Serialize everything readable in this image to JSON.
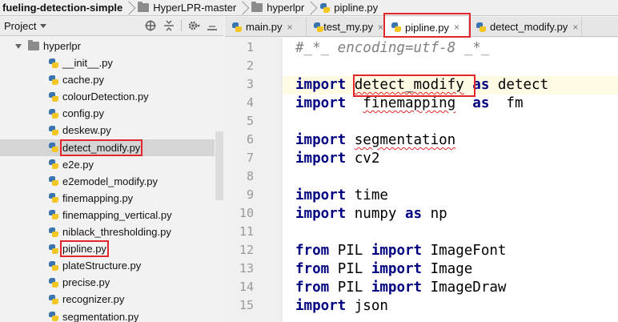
{
  "breadcrumb": {
    "items": [
      {
        "label": "fueling-detection-simple",
        "icon": "none"
      },
      {
        "label": "HyperLPR-master",
        "icon": "folder-icon"
      },
      {
        "label": "hyperlpr",
        "icon": "folder-icon"
      },
      {
        "label": "pipline.py",
        "icon": "python-file-icon"
      }
    ]
  },
  "project_panel": {
    "title": "Project",
    "tools": [
      "globe-icon",
      "collapse-icon",
      "gear-icon",
      "hide-icon"
    ],
    "root_folder": "hyperlpr",
    "files": [
      "__init__.py",
      "cache.py",
      "colourDetection.py",
      "config.py",
      "deskew.py",
      "detect_modify.py",
      "e2e.py",
      "e2emodel_modify.py",
      "finemapping.py",
      "finemapping_vertical.py",
      "niblack_thresholding.py",
      "pipline.py",
      "plateStructure.py",
      "precise.py",
      "recognizer.py",
      "segmentation.py"
    ],
    "selected_file": "detect_modify.py"
  },
  "tabs": [
    {
      "label": "main.py",
      "close": "×",
      "active": false
    },
    {
      "label": "test_my.py",
      "close": "×",
      "active": false
    },
    {
      "label": "pipline.py",
      "close": "×",
      "active": true
    },
    {
      "label": "detect_modify.py",
      "close": "×",
      "active": false
    }
  ],
  "editor": {
    "line_numbers": [
      "1",
      "2",
      "3",
      "4",
      "5",
      "6",
      "7",
      "8",
      "9",
      "10",
      "11",
      "12",
      "13",
      "14",
      "15"
    ],
    "current_line": 3,
    "lines": [
      [
        {
          "t": "#_*_ encoding=utf-8 _*_",
          "c": "comment"
        }
      ],
      [],
      [
        {
          "t": "import",
          "c": "kw"
        },
        {
          "t": " "
        },
        {
          "t": "detect_modify",
          "c": "squig"
        },
        {
          "t": " "
        },
        {
          "t": "as",
          "c": "kw"
        },
        {
          "t": " detect"
        }
      ],
      [
        {
          "t": "import",
          "c": "kw"
        },
        {
          "t": "  "
        },
        {
          "t": "finemapping",
          "c": "squig"
        },
        {
          "t": "  "
        },
        {
          "t": "as",
          "c": "kw"
        },
        {
          "t": "  fm"
        }
      ],
      [],
      [
        {
          "t": "import",
          "c": "kw"
        },
        {
          "t": " "
        },
        {
          "t": "segmentation",
          "c": "squig"
        }
      ],
      [
        {
          "t": "import",
          "c": "kw"
        },
        {
          "t": " cv2"
        }
      ],
      [],
      [
        {
          "t": "import",
          "c": "kw"
        },
        {
          "t": " time"
        }
      ],
      [
        {
          "t": "import",
          "c": "kw"
        },
        {
          "t": " numpy "
        },
        {
          "t": "as",
          "c": "kw"
        },
        {
          "t": " np"
        }
      ],
      [],
      [
        {
          "t": "from",
          "c": "kw"
        },
        {
          "t": " PIL "
        },
        {
          "t": "import",
          "c": "kw"
        },
        {
          "t": " ImageFont"
        }
      ],
      [
        {
          "t": "from",
          "c": "kw"
        },
        {
          "t": " PIL "
        },
        {
          "t": "import",
          "c": "kw"
        },
        {
          "t": " Image"
        }
      ],
      [
        {
          "t": "from",
          "c": "kw"
        },
        {
          "t": " PIL "
        },
        {
          "t": "import",
          "c": "kw"
        },
        {
          "t": " ImageDraw"
        }
      ],
      [
        {
          "t": "import",
          "c": "kw"
        },
        {
          "t": " json"
        }
      ]
    ]
  }
}
